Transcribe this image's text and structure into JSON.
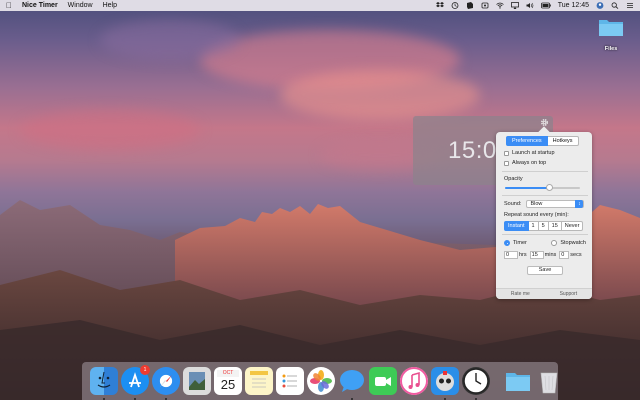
{
  "menubar": {
    "app_name": "Nice Timer",
    "menus": [
      "Window",
      "Help"
    ],
    "clock": "Tue 12:45"
  },
  "desktop": {
    "folder_label": "Files"
  },
  "timer": {
    "display": "15:0"
  },
  "preferences": {
    "tabs": [
      "Preferences",
      "Hotkeys"
    ],
    "launch_at_startup": "Launch at startup",
    "always_on_top": "Always on top",
    "opacity_label": "Opacity",
    "opacity_value": 0.6,
    "sound_label": "Sound:",
    "sound_value": "Blow",
    "repeat_label": "Repeat sound every (min):",
    "repeat_options": [
      "Instant",
      "1",
      "5",
      "15",
      "Never"
    ],
    "mode_timer": "Timer",
    "mode_stopwatch": "Stopwatch",
    "hrs_value": "0",
    "hrs_label": "hrs",
    "mins_value": "15",
    "mins_label": "mins",
    "secs_value": "0",
    "secs_label": "secs",
    "save_label": "Save",
    "rate_label": "Rate me",
    "support_label": "Support"
  },
  "dock": {
    "calendar_month": "OCT",
    "calendar_day": "25",
    "appstore_badge": "1"
  },
  "colors": {
    "accent": "#3b8df5"
  }
}
